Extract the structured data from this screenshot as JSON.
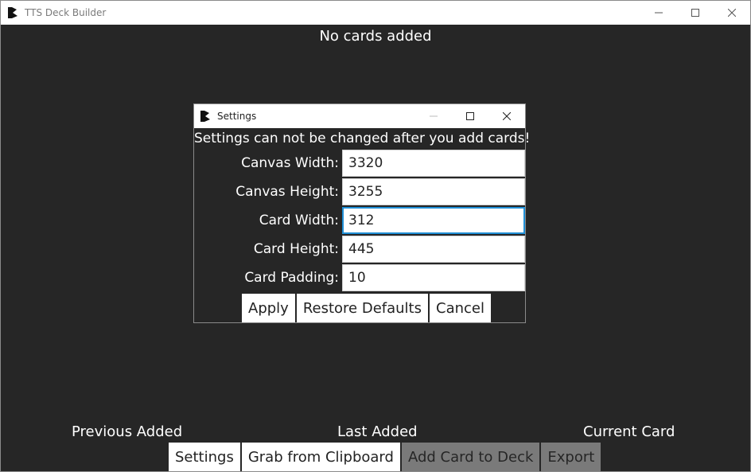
{
  "window": {
    "title": "TTS Deck Builder"
  },
  "main": {
    "status": "No cards added"
  },
  "slots": {
    "previous": "Previous Added",
    "last": "Last Added",
    "current": "Current Card"
  },
  "toolbar": {
    "settings": "Settings",
    "grab": "Grab from Clipboard",
    "add": "Add Card to Deck",
    "export": "Export"
  },
  "settings_dialog": {
    "title": "Settings",
    "warning": "Settings can not be changed after you add cards!",
    "fields": [
      {
        "label": "Canvas Width:",
        "value": "3320"
      },
      {
        "label": "Canvas Height:",
        "value": "3255"
      },
      {
        "label": "Card Width:",
        "value": "312"
      },
      {
        "label": "Card Height:",
        "value": "445"
      },
      {
        "label": "Card Padding:",
        "value": "10"
      }
    ],
    "apply": "Apply",
    "restore": "Restore Defaults",
    "cancel": "Cancel"
  },
  "colors": {
    "background": "#262626",
    "disabled_button": "#7a7a7a",
    "focus": "#1f8fd6"
  }
}
